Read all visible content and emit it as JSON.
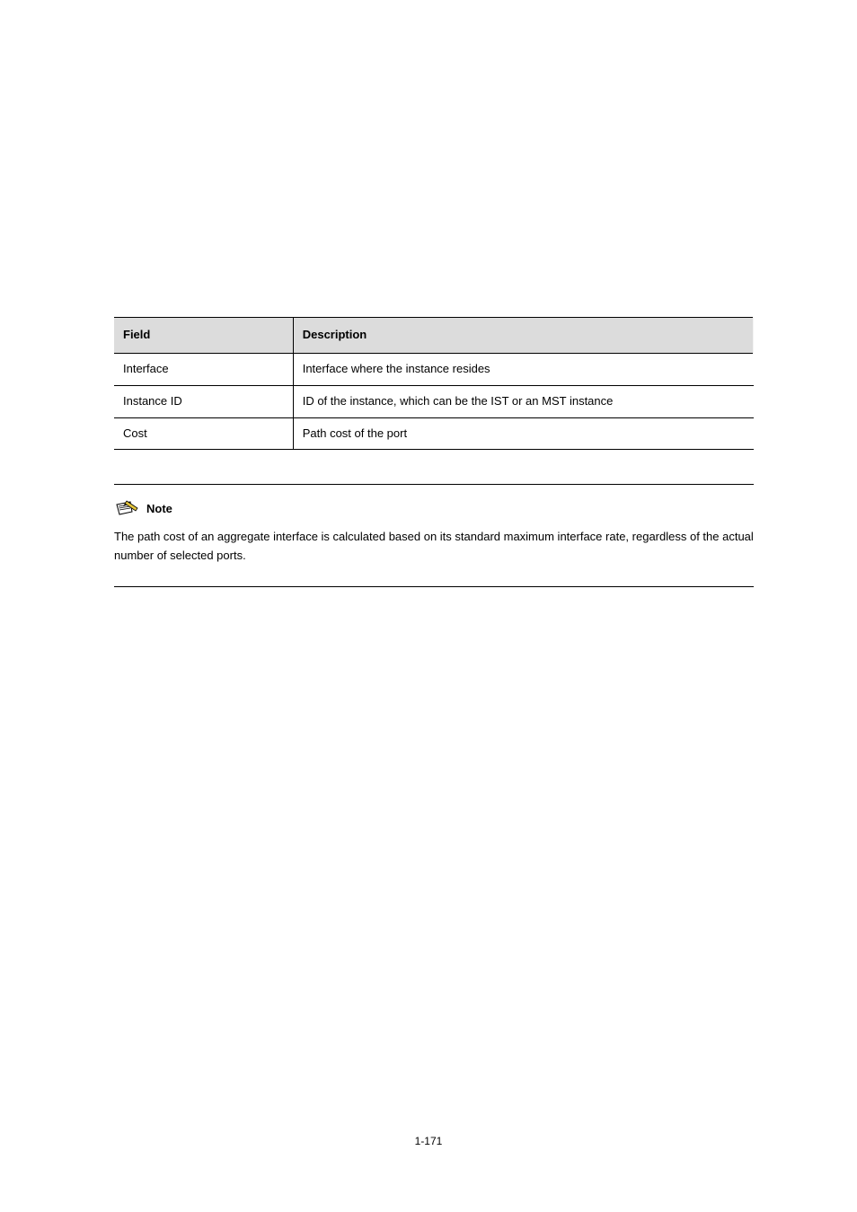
{
  "table": {
    "headers": {
      "field": "Field",
      "description": "Description"
    },
    "rows": [
      {
        "field": "Interface",
        "description": "Interface where the instance resides"
      },
      {
        "field": "Instance ID",
        "description": "ID of the instance, which can be the IST or an MST instance"
      },
      {
        "field": "Cost",
        "description": "Path cost of the port"
      }
    ]
  },
  "note": {
    "label": "Note",
    "text": "The path cost of an aggregate interface is calculated based on its standard maximum interface rate, regardless of the actual number of selected ports."
  },
  "page_number": "1-171"
}
